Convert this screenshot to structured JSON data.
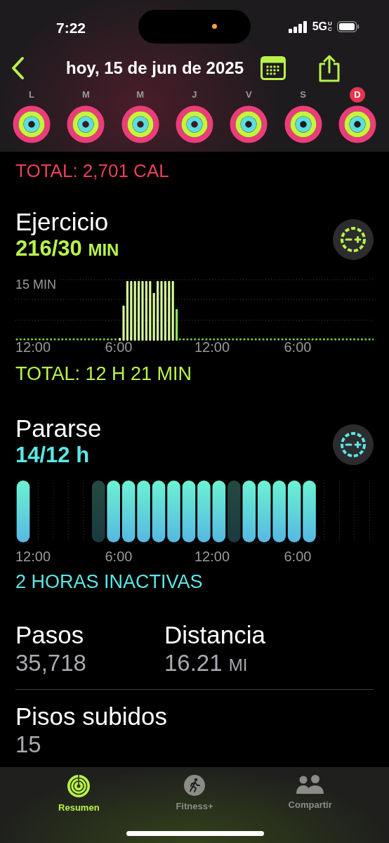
{
  "status_bar": {
    "time": "7:22",
    "network": "5G",
    "network_suffix": "UC"
  },
  "nav": {
    "title": "hoy, 15 de jun de 2025"
  },
  "week": [
    {
      "label": "L",
      "selected": false
    },
    {
      "label": "M",
      "selected": false
    },
    {
      "label": "M",
      "selected": false
    },
    {
      "label": "J",
      "selected": false
    },
    {
      "label": "V",
      "selected": false
    },
    {
      "label": "S",
      "selected": false
    },
    {
      "label": "D",
      "selected": true
    }
  ],
  "move": {
    "total": "TOTAL: 2,701 CAL"
  },
  "exercise": {
    "title": "Ejercicio",
    "value": "216/30",
    "unit": "MIN",
    "gridline_label": "15 MIN",
    "x_labels": [
      "12:00",
      "6:00",
      "12:00",
      "6:00"
    ],
    "total": "TOTAL: 12 H 21 MIN"
  },
  "stand": {
    "title": "Pararse",
    "value": "14/12 h",
    "x_labels": [
      "12:00",
      "6:00",
      "12:00",
      "6:00"
    ],
    "total": "2 HORAS INACTIVAS",
    "hours": [
      {
        "kind": "stood"
      },
      {
        "kind": "empty"
      },
      {
        "kind": "empty"
      },
      {
        "kind": "empty"
      },
      {
        "kind": "empty"
      },
      {
        "kind": "inactive"
      },
      {
        "kind": "stood"
      },
      {
        "kind": "stood"
      },
      {
        "kind": "stood"
      },
      {
        "kind": "stood"
      },
      {
        "kind": "stood"
      },
      {
        "kind": "stood"
      },
      {
        "kind": "stood"
      },
      {
        "kind": "stood"
      },
      {
        "kind": "inactive"
      },
      {
        "kind": "stood"
      },
      {
        "kind": "stood"
      },
      {
        "kind": "stood"
      },
      {
        "kind": "stood"
      },
      {
        "kind": "stood"
      },
      {
        "kind": "empty"
      },
      {
        "kind": "empty"
      },
      {
        "kind": "empty"
      },
      {
        "kind": "empty"
      }
    ]
  },
  "stats": [
    {
      "label": "Pasos",
      "value": "35,718"
    },
    {
      "label": "Distancia",
      "value": "16.21",
      "unit": "MI"
    }
  ],
  "floors": {
    "label": "Pisos subidos",
    "value": "15"
  },
  "tabs": [
    {
      "label": "Resumen",
      "selected": true
    },
    {
      "label": "Fitness+",
      "selected": false
    },
    {
      "label": "Compartir",
      "selected": false
    }
  ]
}
